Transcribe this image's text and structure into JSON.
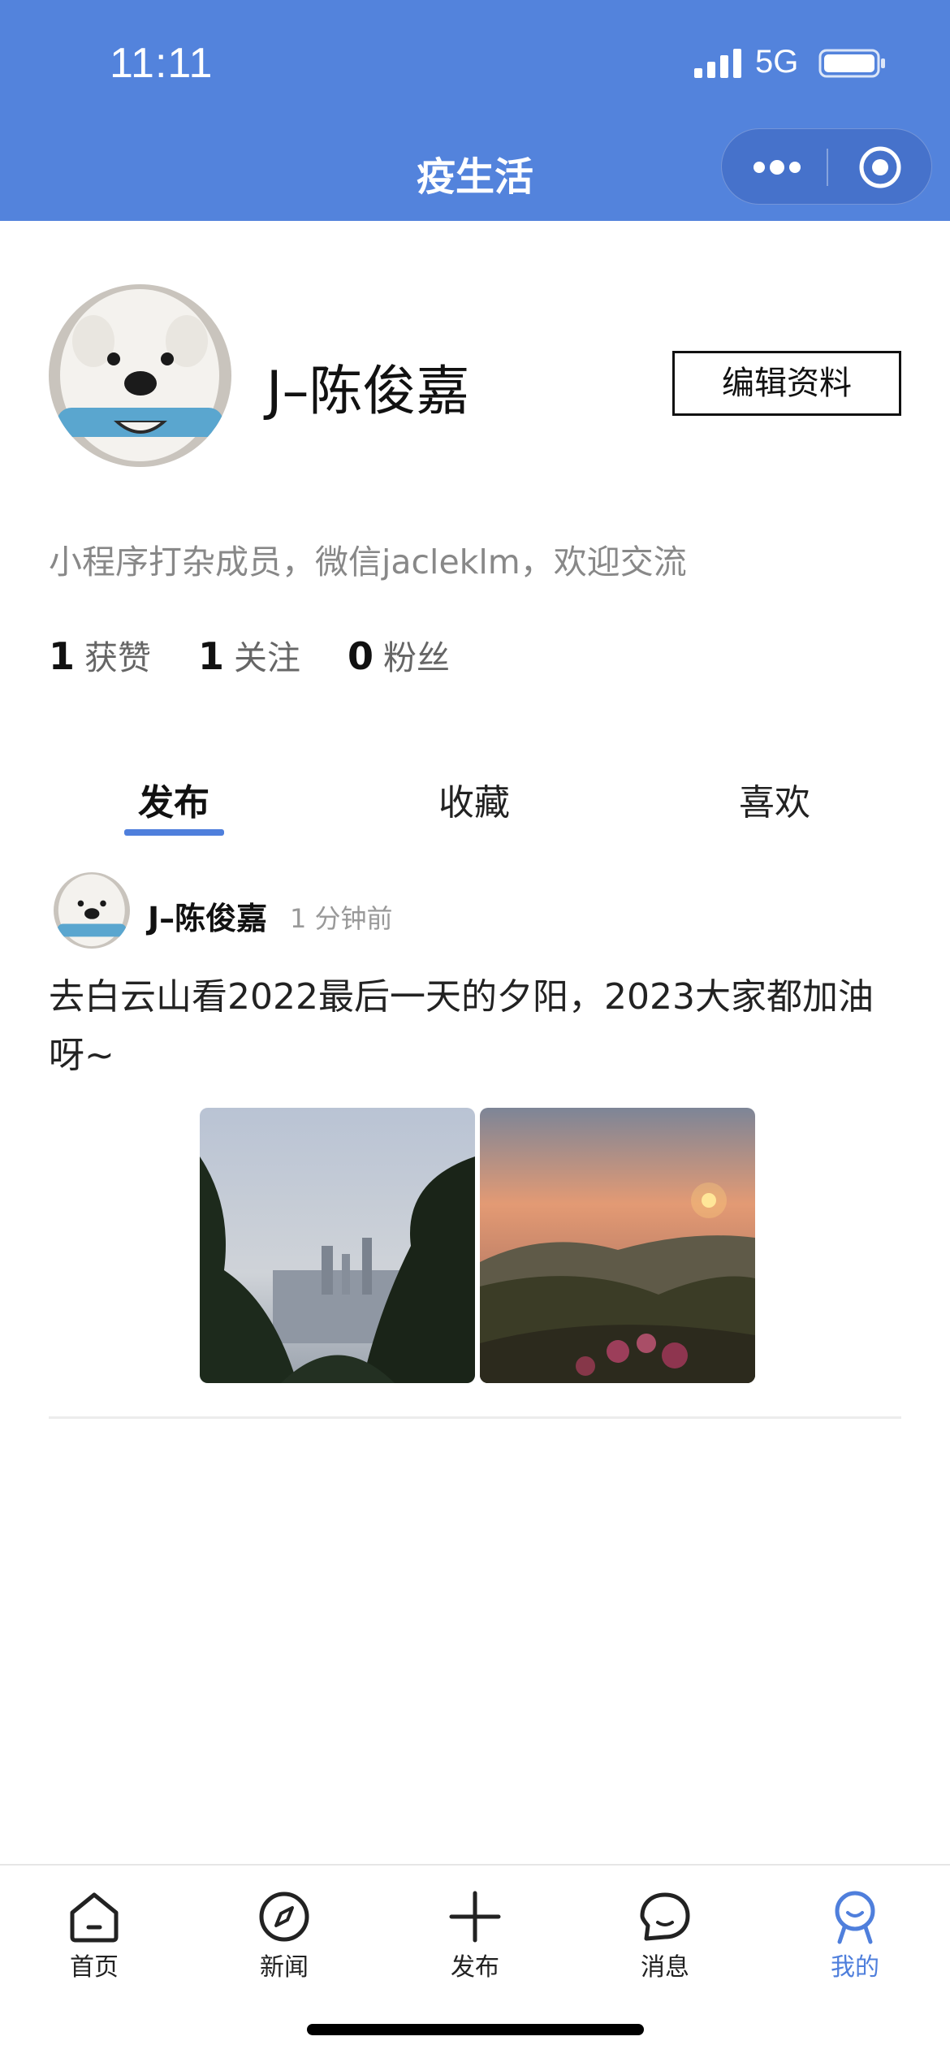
{
  "status_bar": {
    "time": "11:11",
    "network": "5G"
  },
  "nav": {
    "title": "疫生活"
  },
  "profile": {
    "name": "J–陈俊嘉",
    "edit_label": "编辑资料",
    "bio": "小程序打杂成员，微信jacleklm，欢迎交流",
    "stats": [
      {
        "value": "1",
        "label": "获赞"
      },
      {
        "value": "1",
        "label": "关注"
      },
      {
        "value": "0",
        "label": "粉丝"
      }
    ]
  },
  "tabs": [
    {
      "label": "发布",
      "active": true
    },
    {
      "label": "收藏",
      "active": false
    },
    {
      "label": "喜欢",
      "active": false
    }
  ],
  "post": {
    "author": "J–陈俊嘉",
    "time": "1 分钟前",
    "text": "去白云山看2022最后一天的夕阳，2023大家都加油呀~"
  },
  "tabbar": [
    {
      "label": "首页",
      "icon": "home-icon",
      "active": false
    },
    {
      "label": "新闻",
      "icon": "compass-icon",
      "active": false
    },
    {
      "label": "发布",
      "icon": "plus-icon",
      "active": false
    },
    {
      "label": "消息",
      "icon": "chat-icon",
      "active": false
    },
    {
      "label": "我的",
      "icon": "profile-icon",
      "active": true
    }
  ],
  "colors": {
    "header": "#5383DC",
    "accent": "#4F7FDC"
  }
}
